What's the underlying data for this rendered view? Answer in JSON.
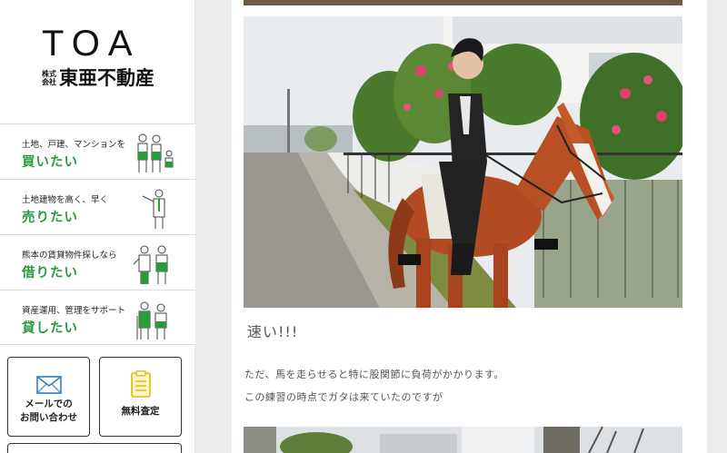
{
  "logo": {
    "en": "TOA",
    "jp_small_1": "株式",
    "jp_small_2": "会社",
    "jp_big": "東亜不動産"
  },
  "menu": [
    {
      "sub": "土地、戸建、マンションを",
      "main": "買いたい",
      "icon": "buyers-figures-icon"
    },
    {
      "sub": "土地建物を高く、早く",
      "main": "売りたい",
      "icon": "seller-figure-icon"
    },
    {
      "sub": "熊本の賃貸物件探しなら",
      "main": "借りたい",
      "icon": "renters-figures-icon"
    },
    {
      "sub": "資産運用、管理をサポート",
      "main": "貸したい",
      "icon": "landlords-figures-icon"
    }
  ],
  "buttons": {
    "mail_label": "メールでの\nお問い合わせ",
    "mail_icon": "envelope-icon",
    "free_label": "無料査定",
    "free_icon": "clipboard-icon"
  },
  "article": {
    "caption": "速い!!!",
    "para1": "ただ、馬を走らせると特に股関節に負荷がかかります。",
    "para2": "この練習の時点でガタは来ていたのですが"
  },
  "colors": {
    "accent_green": "#2a9a3c",
    "accent_blue": "#2f7fc0",
    "accent_yellow": "#e8b800"
  }
}
